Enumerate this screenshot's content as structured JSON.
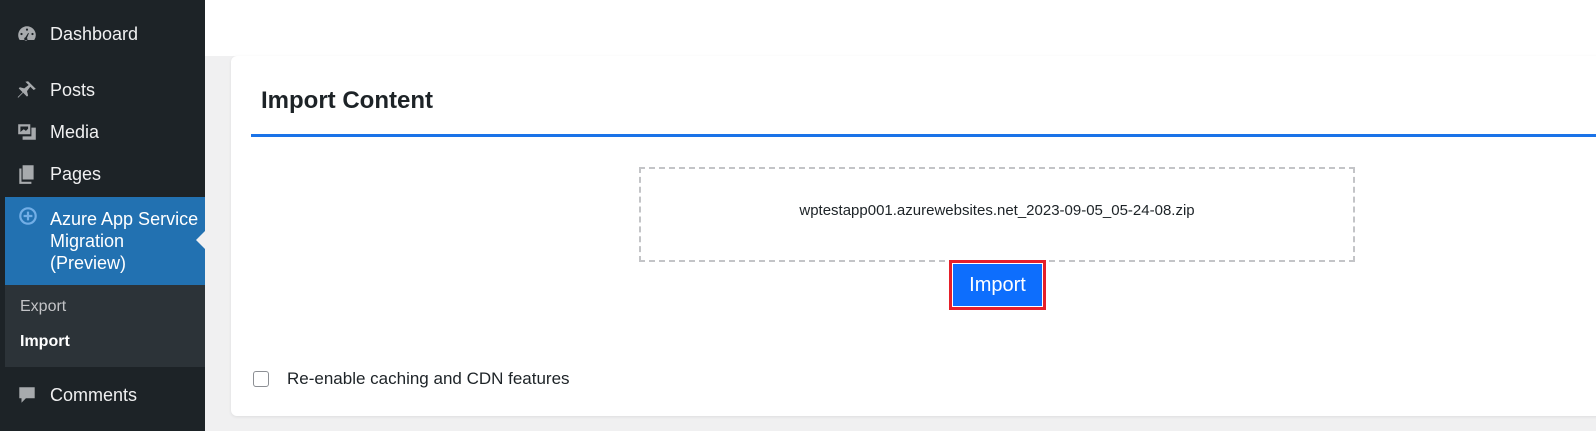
{
  "sidebar": {
    "items": [
      {
        "id": "dashboard",
        "label": "Dashboard",
        "icon": "dashboard-icon"
      },
      {
        "id": "posts",
        "label": "Posts",
        "icon": "pin-icon"
      },
      {
        "id": "media",
        "label": "Media",
        "icon": "media-icon"
      },
      {
        "id": "pages",
        "label": "Pages",
        "icon": "pages-icon"
      },
      {
        "id": "azure",
        "label": "Azure App Service Migration (Preview)",
        "icon": "azure-icon",
        "active": true
      },
      {
        "id": "comments",
        "label": "Comments",
        "icon": "comment-icon"
      }
    ],
    "submenu": {
      "export_label": "Export",
      "import_label": "Import"
    }
  },
  "main": {
    "title": "Import Content",
    "dropzone_filename": "wptestapp001.azurewebsites.net_2023-09-05_05-24-08.zip",
    "import_button_label": "Import",
    "checkbox_label": "Re-enable caching and CDN features",
    "checkbox_checked": false
  },
  "colors": {
    "sidebar_bg": "#1d2327",
    "active_bg": "#2271b1",
    "accent_rule": "#1a73e8",
    "button_bg": "#0d6efd",
    "highlight_outline": "#e5202a"
  }
}
